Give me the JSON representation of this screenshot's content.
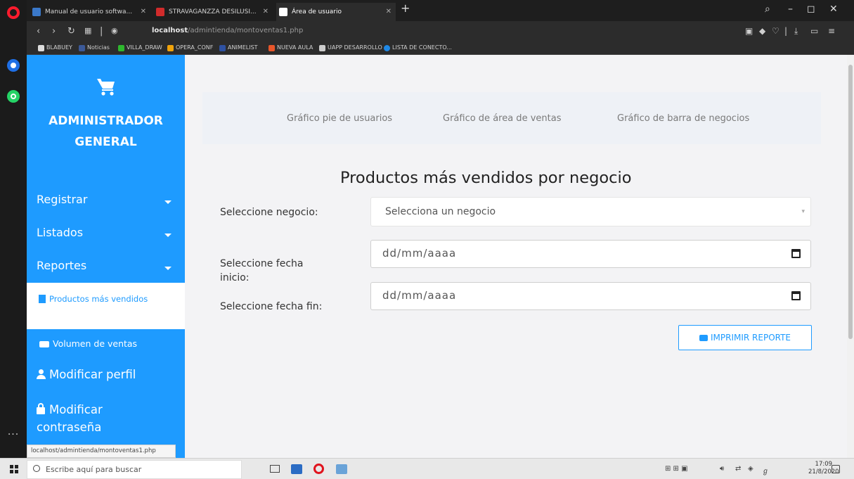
{
  "browser": {
    "tabs": [
      {
        "title": "Manual de usuario softwa..."
      },
      {
        "title": "STRAVAGANZZA DESILUSI..."
      },
      {
        "title": "Área de usuario"
      }
    ],
    "url_host": "localhost",
    "url_path": "/admintienda/montoventas1.php",
    "bookmarks": [
      {
        "label": "BLABUEY",
        "color": "#4a90e2"
      },
      {
        "label": "Noticias",
        "color": "#3b5998"
      },
      {
        "label": "VILLA_DRAW",
        "color": "#2eb82e"
      },
      {
        "label": "OPERA_CONF",
        "color": "#f0a30a"
      },
      {
        "label": "ANIMELIST",
        "color": "#2e51a2"
      },
      {
        "label": "NUEVA AULA",
        "color": "#e8562a"
      },
      {
        "label": "UAPP DESARROLLO",
        "color": "#cccccc"
      },
      {
        "label": "LISTA DE CONECTO...",
        "color": "#1e88e5"
      }
    ]
  },
  "sidebar": {
    "title_line1": "ADMINISTRADOR",
    "title_line2": "GENERAL",
    "menu": [
      {
        "label": "Registrar"
      },
      {
        "label": "Listados"
      },
      {
        "label": "Reportes"
      }
    ],
    "active_sub": "Productos más vendidos",
    "sub_item": "Volumen de ventas",
    "modify_profile": "Modificar perfil",
    "modify_password_line1": "Modificar",
    "modify_password_line2": "contraseña",
    "status_url": "localhost/admintienda/montoventas1.php"
  },
  "chart_nav": {
    "pie": "Gráfico pie de usuarios",
    "area": "Gráfico de área de ventas",
    "bar": "Gráfico de barra de negocios"
  },
  "form": {
    "heading": "Productos más vendidos por negocio",
    "business_label": "Seleccione negocio:",
    "business_value": "Selecciona un negocio",
    "start_label_line1": "Seleccione fecha",
    "start_label_line2": "inicio:",
    "start_placeholder": "dd/mm/aaaa",
    "end_label": "Seleccione fecha fin:",
    "end_placeholder": "dd/mm/aaaa",
    "print_button": "IMPRIMIR REPORTE"
  },
  "taskbar": {
    "search_placeholder": "Escribe aquí para buscar",
    "time": "17:09",
    "date": "21/8/2020"
  },
  "colors": {
    "accent": "#1e9bff",
    "sidebar_bg": "#1e9bff"
  }
}
